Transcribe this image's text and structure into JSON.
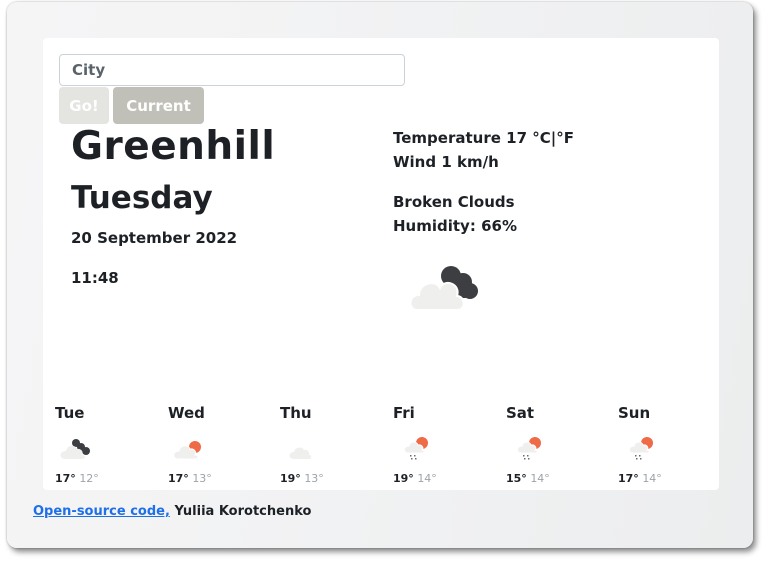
{
  "search": {
    "placeholder": "City",
    "value": ""
  },
  "buttons": {
    "go_label": "Go!",
    "current_label": "Current"
  },
  "current": {
    "city": "Greenhill",
    "day": "Tuesday",
    "date": "20 September 2022",
    "time": "11:48",
    "temperature_label": "Temperature",
    "temperature_value": "17",
    "unit_celsius": "°C",
    "unit_separator": "|",
    "unit_fahrenheit": "°F",
    "wind_label": "Wind",
    "wind_value": "1",
    "wind_unit": "km/h",
    "description": "Broken Clouds",
    "humidity_label": "Humidity:",
    "humidity_value": "66%",
    "icon": "broken-clouds-icon"
  },
  "forecast": [
    {
      "day": "Tue",
      "max": "17°",
      "min": "12°",
      "icon": "broken-clouds-icon"
    },
    {
      "day": "Wed",
      "max": "17°",
      "min": "13°",
      "icon": "few-clouds-icon"
    },
    {
      "day": "Thu",
      "max": "19°",
      "min": "13°",
      "icon": "cloud-icon"
    },
    {
      "day": "Fri",
      "max": "19°",
      "min": "14°",
      "icon": "rain-sun-icon"
    },
    {
      "day": "Sat",
      "max": "15°",
      "min": "14°",
      "icon": "rain-sun-icon"
    },
    {
      "day": "Sun",
      "max": "17°",
      "min": "14°",
      "icon": "rain-sun-icon"
    }
  ],
  "footer": {
    "link_text": "Open-source code,",
    "author": "Yuliia Korotchenko"
  },
  "colors": {
    "sun": "#ef6a47",
    "dark_cloud": "#3d3e42",
    "light_cloud": "#efefee",
    "link": "#1e6fe8"
  }
}
